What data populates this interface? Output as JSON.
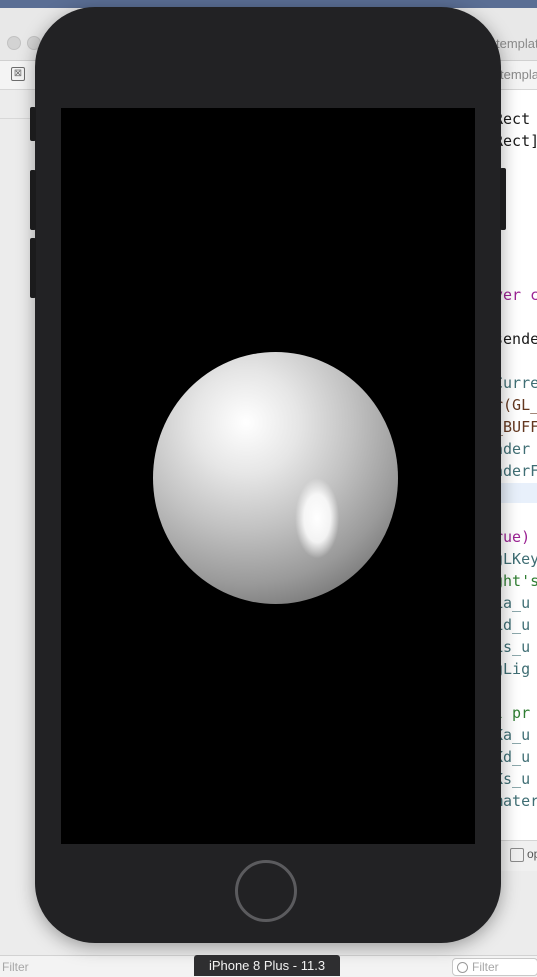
{
  "xcode": {
    "tab_label": "templat",
    "toolbar_tab_label": "templa",
    "code_lines": [
      {
        "text": "Rect",
        "color": "#1a1a1a"
      },
      {
        "text": "Rect]",
        "color": "#1a1a1a"
      },
      {
        "text": "ver c",
        "color": "#9b2393"
      },
      {
        "text": "sende",
        "color": "#1a1a1a"
      },
      {
        "text": "Curre",
        "color": "#3f6e74"
      },
      {
        "text": "r(GL_",
        "color": "#643820"
      },
      {
        "text": "_BUFF",
        "color": "#643820"
      },
      {
        "text": "nder",
        "color": "#3f6e74"
      },
      {
        "text": "nderF",
        "color": "#3f6e74"
      },
      {
        "text": "rue)",
        "color": "#9b2393"
      },
      {
        "text": "gLKey",
        "color": "#3f6e74"
      },
      {
        "text": "ght's",
        "color": "#2f7d32"
      },
      {
        "text": "La_u",
        "color": "#3f6e74"
      },
      {
        "text": "Ld_u",
        "color": "#3f6e74"
      },
      {
        "text": "Ls_u",
        "color": "#3f6e74"
      },
      {
        "text": "gLig",
        "color": "#3f6e74"
      },
      {
        "text": "l pr",
        "color": "#2f7d32"
      },
      {
        "text": "Ka_u",
        "color": "#3f6e74"
      },
      {
        "text": "Kd_u",
        "color": "#3f6e74"
      },
      {
        "text": "Ks_u",
        "color": "#3f6e74"
      },
      {
        "text": "mater",
        "color": "#3f6e74"
      }
    ],
    "filter_left_placeholder": "Filter",
    "filter_right_placeholder": "Filter",
    "footer_right_label": "op"
  },
  "simulator": {
    "device_label": "iPhone 8 Plus - 11.3",
    "scene": "shaded sphere",
    "colors": {
      "bezel": "#222224",
      "screen_background": "#000000"
    }
  }
}
